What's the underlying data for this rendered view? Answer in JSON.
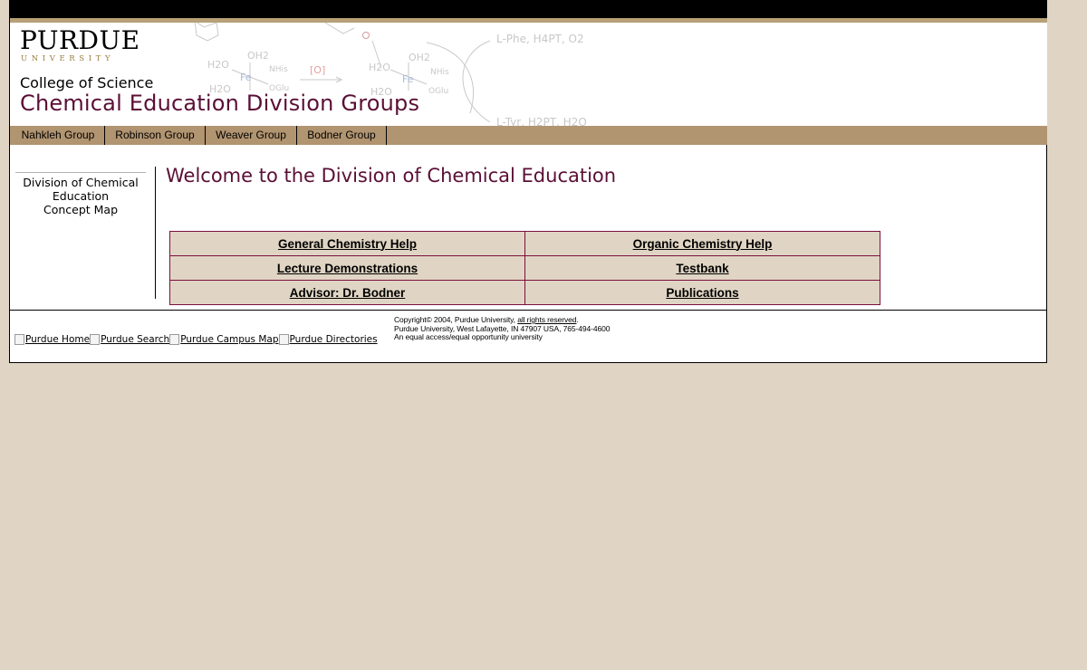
{
  "header": {
    "logo_word": "PURDUE",
    "logo_sub": "UNIVERSITY",
    "college": "College of Science",
    "title": "Chemical Education Division Groups",
    "art_labels": {
      "oh2_a": "OH2",
      "h2o_a": "H2O",
      "fe_a": "Fe",
      "nhis_a": "NHis",
      "oglu_a": "OGlu",
      "h2o_b": "H2O",
      "oxidant": "[O]",
      "oh2_b": "OH2",
      "h2o_c": "H2O",
      "fe_b": "Fe",
      "nhis_b": "NHis",
      "oglu_b": "OGlu",
      "h2o_d": "H2O",
      "phe": "L-Phe, H4PT, O2",
      "tyr": "L-Tyr, H2PT, H2O"
    }
  },
  "nav": {
    "items": [
      "Nahkleh Group",
      "Robinson Group",
      "Weaver Group",
      "Bodner Group"
    ]
  },
  "sidebar": {
    "line1": "Division of Chemical",
    "line2": "Education",
    "line3": "Concept Map"
  },
  "main": {
    "welcome": "Welcome to the Division of Chemical Education",
    "links": [
      [
        "General Chemistry Help",
        "Organic Chemistry Help"
      ],
      [
        "Lecture Demonstrations",
        "Testbank"
      ],
      [
        "Advisor: Dr. Bodner",
        "Publications"
      ]
    ]
  },
  "footer": {
    "links": [
      "Purdue Home",
      "Purdue Search",
      "Purdue Campus Map",
      "Purdue Directories"
    ],
    "copyright_pre": "Copyright© 2004, Purdue University, ",
    "copyright_link": "all rights reserved",
    "copyright_post": ".",
    "address": "Purdue University, West Lafayette, IN 47907 USA, 765-494-4600",
    "equal": "An equal access/equal opportunity university"
  },
  "colors": {
    "background": "#e0d5c4",
    "nav": "#b19470",
    "brand_maroon": "#5b0f36",
    "gold": "#9a7d3e"
  }
}
